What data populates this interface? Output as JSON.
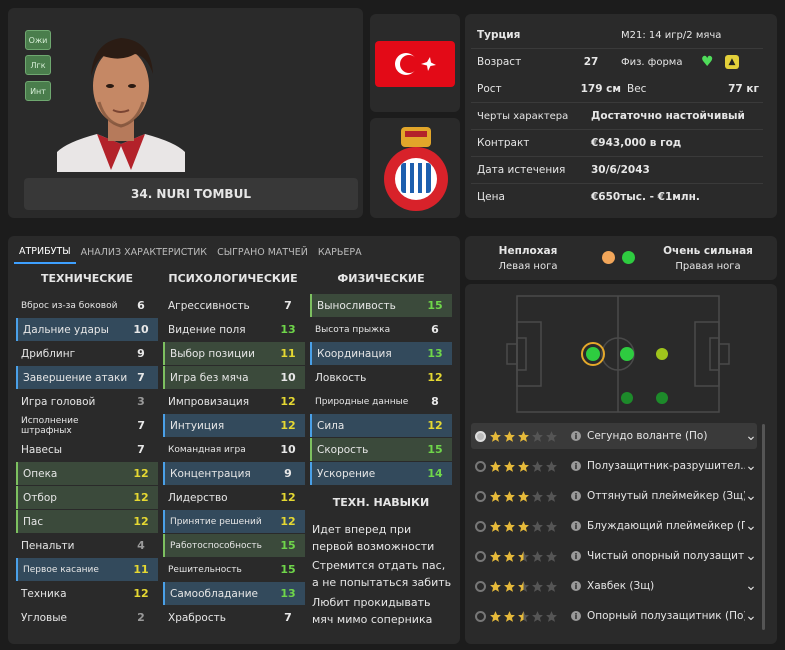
{
  "player": {
    "name": "34. NURI TOMBUL",
    "tags": [
      "Ожи",
      "Лгк",
      "Инт"
    ]
  },
  "info": {
    "nation": "Турция",
    "u21": "М21: 14 игр/2 мяча",
    "age_label": "Возраст",
    "age": "27",
    "fitness_label": "Физ. форма",
    "height_label": "Рост",
    "height": "179 см",
    "weight_label": "Вес",
    "weight": "77 кг",
    "traits_label": "Черты характера",
    "traits": "Достаточно настойчивый",
    "contract_label": "Контракт",
    "contract": "€943,000 в год",
    "expiry_label": "Дата истечения",
    "expiry": "30/6/2043",
    "price_label": "Цена",
    "price": "€650тыс. - €1млн."
  },
  "colors": {
    "accent": "#3ea0ff",
    "highlight_blue": "#334a5c",
    "highlight_green": "#3b4a3b",
    "value_yellow": "#e5d832",
    "value_green": "#6fd64a",
    "good_dot": "#2ecc40"
  },
  "tabs": [
    "АТРИБУТЫ",
    "АНАЛИЗ ХАРАКТЕРИСТИК",
    "СЫГРАНО МАТЧЕЙ",
    "КАРЬЕРА"
  ],
  "attributes": {
    "technical_title": "ТЕХНИЧЕСКИЕ",
    "mental_title": "ПСИХОЛОГИЧЕСКИЕ",
    "physical_title": "ФИЗИЧЕСКИЕ",
    "technical": [
      {
        "label": "Вброс из-за боковой",
        "value": "6"
      },
      {
        "label": "Дальние удары",
        "value": "10"
      },
      {
        "label": "Дриблинг",
        "value": "9"
      },
      {
        "label": "Завершение атаки",
        "value": "7"
      },
      {
        "label": "Игра головой",
        "value": "3"
      },
      {
        "label": "Исполнение штрафных",
        "value": "7"
      },
      {
        "label": "Навесы",
        "value": "7"
      },
      {
        "label": "Опека",
        "value": "12"
      },
      {
        "label": "Отбор",
        "value": "12"
      },
      {
        "label": "Пас",
        "value": "12"
      },
      {
        "label": "Пенальти",
        "value": "4"
      },
      {
        "label": "Первое касание",
        "value": "11"
      },
      {
        "label": "Техника",
        "value": "12"
      },
      {
        "label": "Угловые",
        "value": "2"
      }
    ],
    "mental": [
      {
        "label": "Агрессивность",
        "value": "7"
      },
      {
        "label": "Видение поля",
        "value": "13"
      },
      {
        "label": "Выбор позиции",
        "value": "11"
      },
      {
        "label": "Игра без мяча",
        "value": "10"
      },
      {
        "label": "Импровизация",
        "value": "12"
      },
      {
        "label": "Интуиция",
        "value": "12"
      },
      {
        "label": "Командная игра",
        "value": "10"
      },
      {
        "label": "Концентрация",
        "value": "9"
      },
      {
        "label": "Лидерство",
        "value": "12"
      },
      {
        "label": "Принятие решений",
        "value": "12"
      },
      {
        "label": "Работоспособность",
        "value": "15"
      },
      {
        "label": "Решительность",
        "value": "15"
      },
      {
        "label": "Самообладание",
        "value": "13"
      },
      {
        "label": "Храбрость",
        "value": "7"
      }
    ],
    "physical": [
      {
        "label": "Выносливость",
        "value": "15"
      },
      {
        "label": "Высота прыжка",
        "value": "6"
      },
      {
        "label": "Координация",
        "value": "13"
      },
      {
        "label": "Ловкость",
        "value": "12"
      },
      {
        "label": "Природные данные",
        "value": "8"
      },
      {
        "label": "Сила",
        "value": "12"
      },
      {
        "label": "Скорость",
        "value": "15"
      },
      {
        "label": "Ускорение",
        "value": "14"
      }
    ],
    "tech_skills_title": "ТЕХН. НАВЫКИ",
    "tech_skills": [
      "Идет вперед при первой возможности",
      "Стремится отдать пас, а не попытаться забить",
      "Любит прокидывать мяч мимо соперника"
    ]
  },
  "feet": {
    "left_rating": "Неплохая",
    "left_label": "Левая нога",
    "right_rating": "Очень сильная",
    "right_label": "Правая нога"
  },
  "roles": [
    {
      "name": "Сегундо воланте (По)",
      "stars": 3
    },
    {
      "name": "Полузащитник-разрушител...",
      "stars": 3
    },
    {
      "name": "Оттянутый плеймейкер (Зщ)",
      "stars": 3
    },
    {
      "name": "Блуждающий плеймейкер (По)",
      "stars": 3
    },
    {
      "name": "Чистый опорный полузащит...",
      "stars": 2.5
    },
    {
      "name": "Хавбек (Зщ)",
      "stars": 2.5
    },
    {
      "name": "Опорный полузащитник (По)",
      "stars": 2.5
    }
  ]
}
